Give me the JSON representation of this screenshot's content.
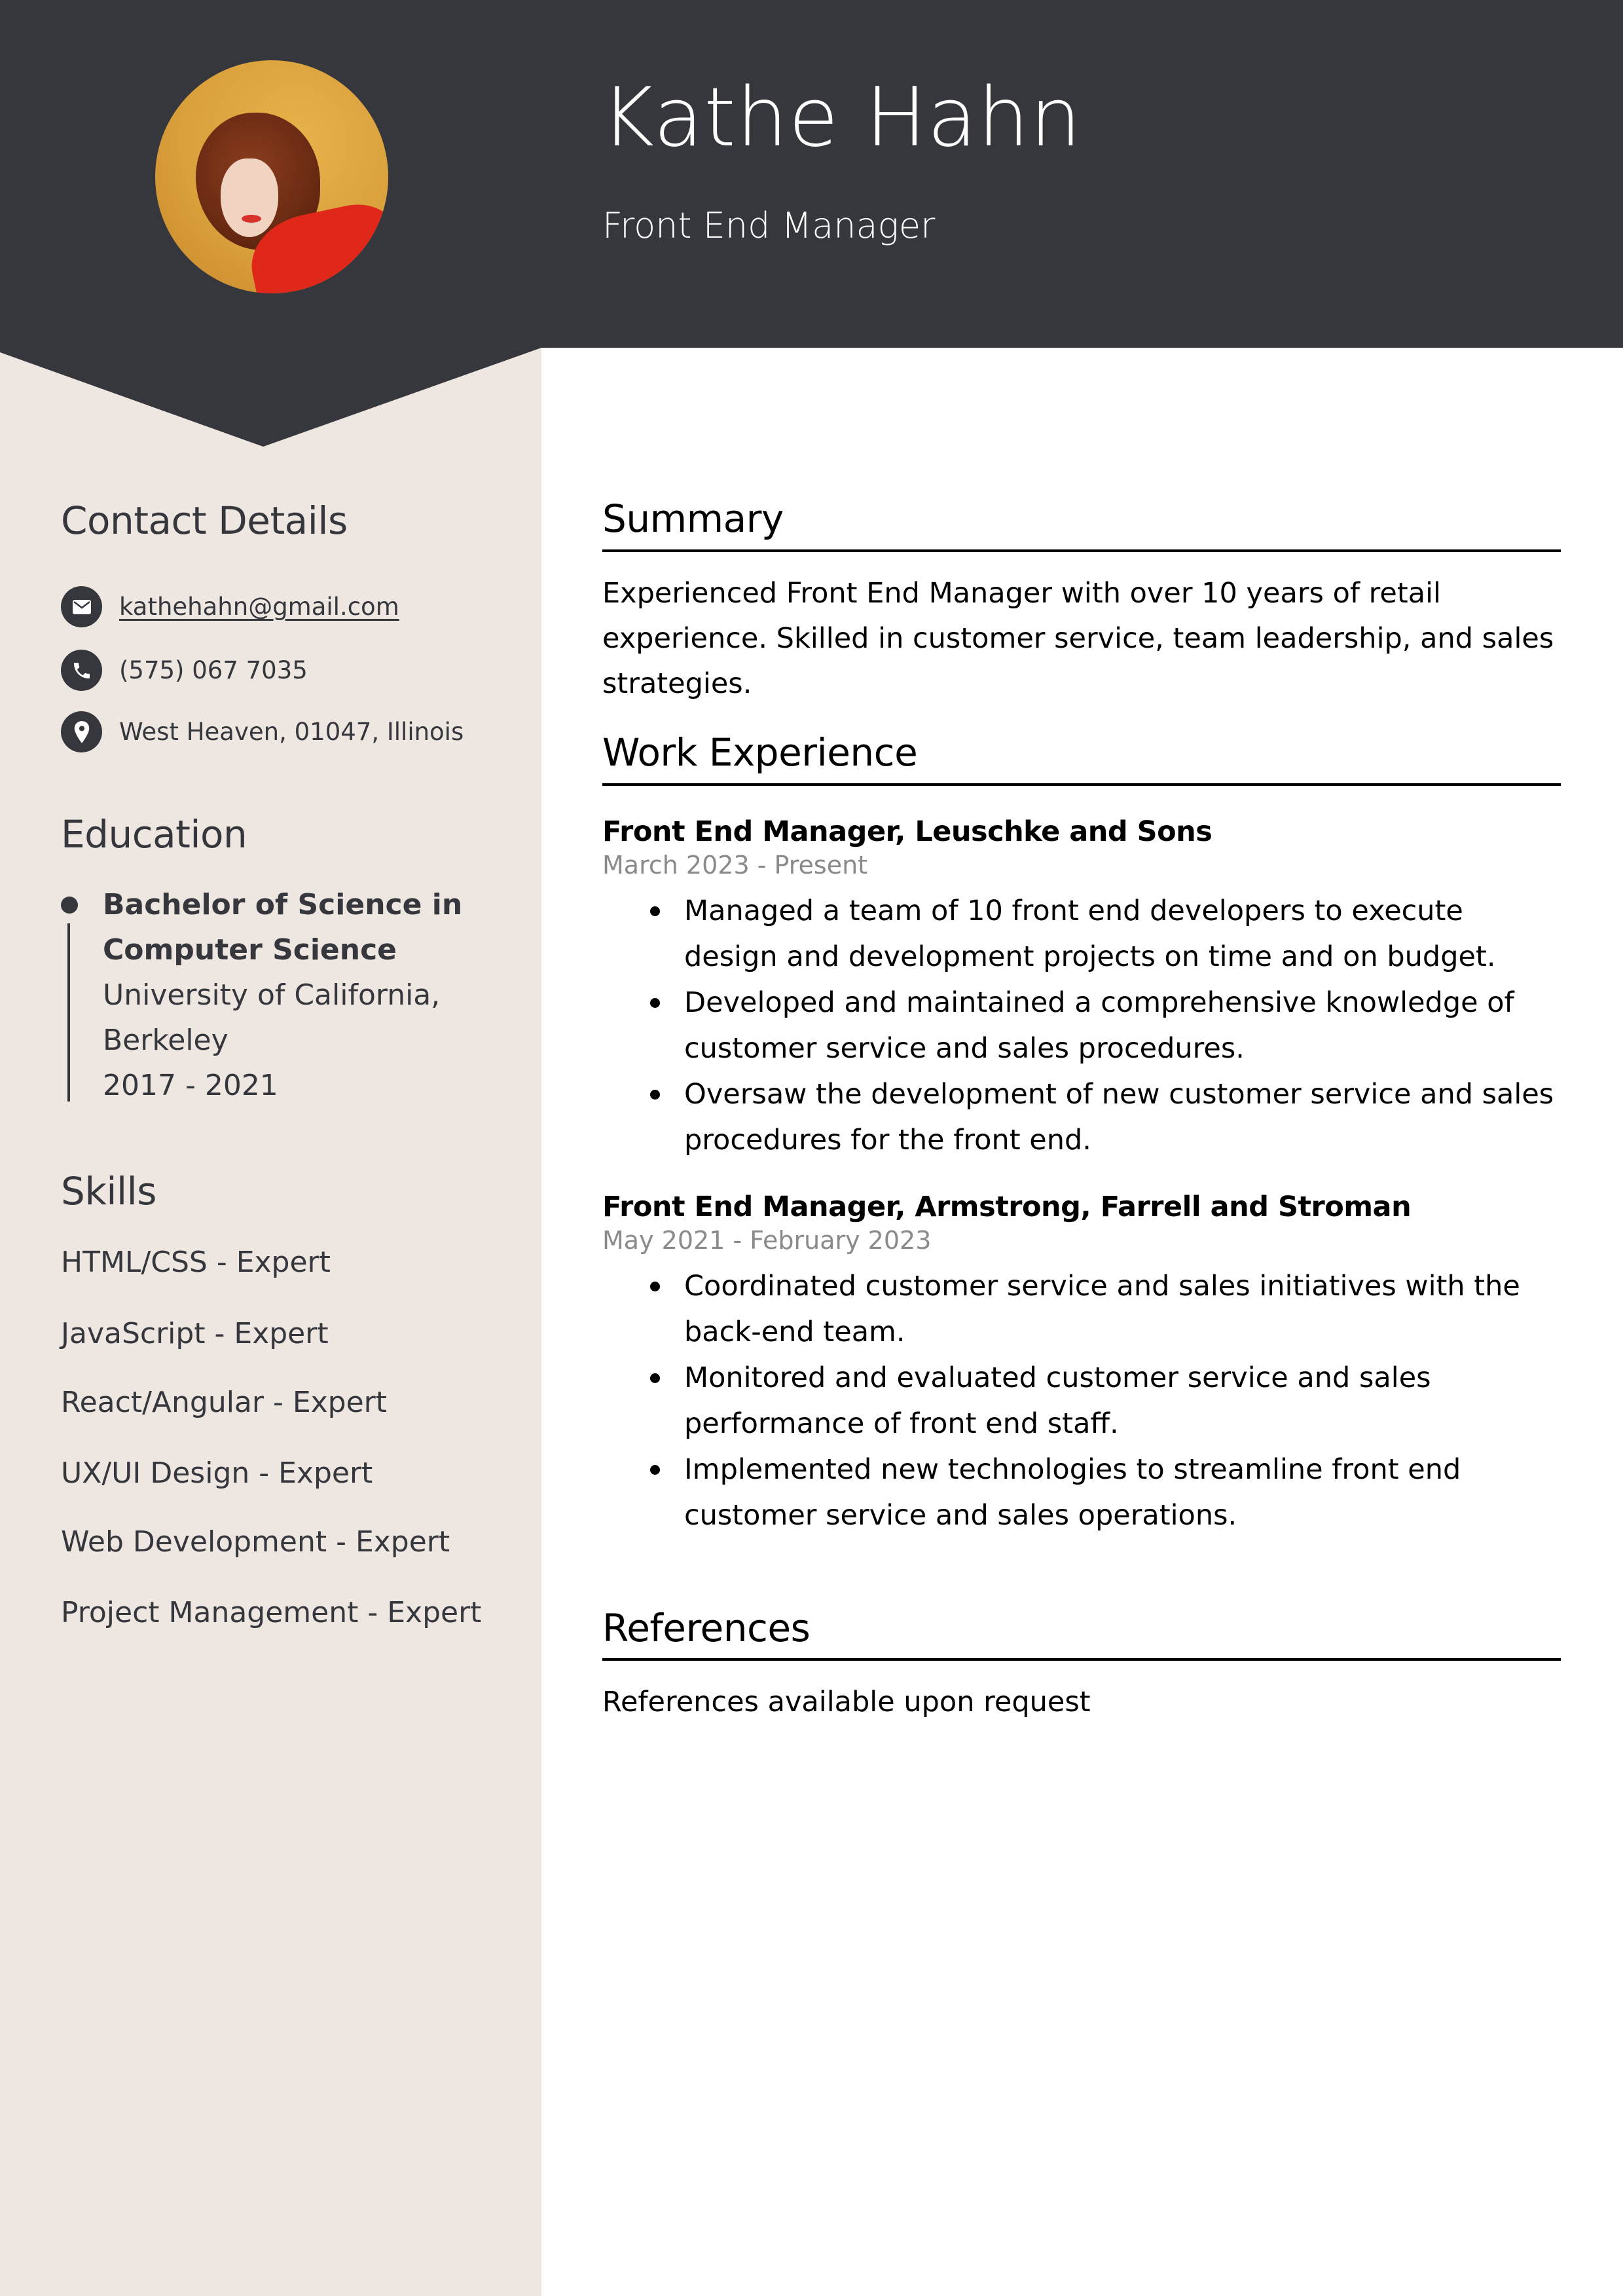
{
  "header": {
    "name": "Kathe Hahn",
    "title": "Front End Manager",
    "photo_alt": "Portrait of Kathe Hahn"
  },
  "colors": {
    "dark": "#36373d",
    "sidebar_bg": "#ede6e1",
    "date_gray": "#8a8a8a"
  },
  "sidebar": {
    "contact": {
      "heading": "Contact Details",
      "items": [
        {
          "icon": "envelope-icon",
          "text": "kathehahn@gmail.com"
        },
        {
          "icon": "phone-icon",
          "text": "(575) 067 7035"
        },
        {
          "icon": "location-pin-icon",
          "text": "West Heaven, 01047, Illinois"
        }
      ]
    },
    "education": {
      "heading": "Education",
      "entries": [
        {
          "degree_lines": [
            "Bachelor of Science in",
            "Computer Science"
          ],
          "school_lines": [
            "University of California,",
            "Berkeley"
          ],
          "years": "2017 - 2021"
        }
      ]
    },
    "skills": {
      "heading": "Skills",
      "items": [
        "HTML/CSS - Expert",
        "JavaScript - Expert",
        "React/Angular - Expert",
        "UX/UI Design - Expert",
        "Web Development - Expert",
        "Project Management - Expert"
      ]
    }
  },
  "main": {
    "summary": {
      "heading": "Summary",
      "text": "Experienced Front End Manager with over 10 years of retail experience. Skilled in customer service, team leadership, and sales strategies."
    },
    "work": {
      "heading": "Work Experience",
      "jobs": [
        {
          "title": "Front End Manager, Leuschke and Sons",
          "dates": "March 2023 - Present",
          "bullets": [
            "Managed a team of 10 front end developers to execute design and development projects on time and on budget.",
            "Developed and maintained a comprehensive knowledge of customer service and sales procedures.",
            "Oversaw the development of new customer service and sales procedures for the front end."
          ]
        },
        {
          "title": "Front End Manager, Armstrong, Farrell and Stroman",
          "dates": "May 2021 - February 2023",
          "bullets": [
            "Coordinated customer service and sales initiatives with the back-end team.",
            "Monitored and evaluated customer service and sales performance of front end staff.",
            "Implemented new technologies to streamline front end customer service and sales operations."
          ]
        }
      ]
    },
    "references": {
      "heading": "References",
      "text": "References available upon request"
    }
  }
}
